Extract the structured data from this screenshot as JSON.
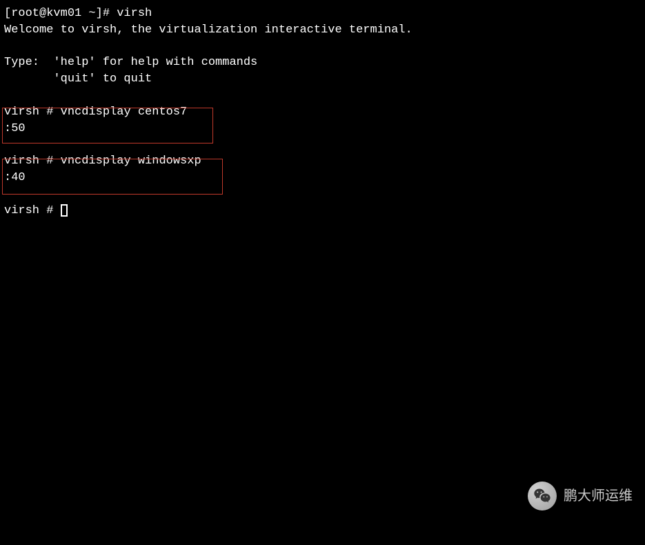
{
  "terminal": {
    "shell_prompt": "[root@kvm01 ~]# ",
    "shell_command": "virsh",
    "welcome": "Welcome to virsh, the virtualization interactive terminal.",
    "help_line1": "Type:  'help' for help with commands",
    "help_line2": "       'quit' to quit",
    "virsh_prompt": "virsh # ",
    "cmd1": "vncdisplay centos7",
    "out1": ":50",
    "cmd2": "vncdisplay windowsxp",
    "out2": ":40"
  },
  "watermark": {
    "text": "鹏大师运维",
    "icon": "wechat-icon"
  }
}
